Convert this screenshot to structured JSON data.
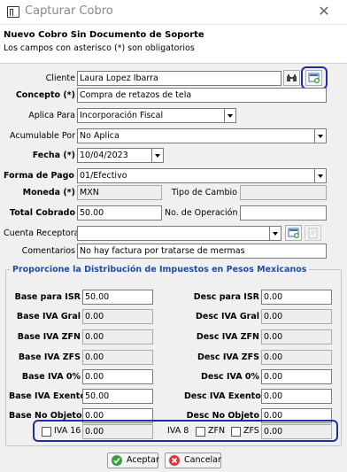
{
  "window": {
    "title": "Capturar Cobro",
    "close_glyph": "✕"
  },
  "header": {
    "title": "Nuevo Cobro Sin Documento de Soporte",
    "subtitle": "Los campos con asterisco (*) son obligatorios"
  },
  "form": {
    "cliente": {
      "label": "Cliente",
      "value": "Laura Lopez Ibarra"
    },
    "concepto": {
      "label": "Concepto (*)",
      "value": "Compra de retazos de tela"
    },
    "aplica_para": {
      "label": "Aplica Para",
      "value": "Incorporación Fiscal"
    },
    "acumulable_por": {
      "label": "Acumulable Por",
      "value": "No Aplica"
    },
    "fecha": {
      "label": "Fecha (*)",
      "value": "10/04/2023"
    },
    "forma_pago": {
      "label": "Forma de Pago (*)",
      "value": "01/Efectivo"
    },
    "moneda": {
      "label": "Moneda (*)",
      "value": "MXN"
    },
    "tipo_cambio": {
      "label": "Tipo de Cambio",
      "value": ""
    },
    "total_cobrado": {
      "label": "Total Cobrado",
      "value": "50.00"
    },
    "no_operacion": {
      "label": "No. de Operación",
      "value": ""
    },
    "cuenta_receptora": {
      "label": "Cuenta Receptora",
      "value": ""
    },
    "comentarios": {
      "label": "Comentarios",
      "value": "No hay factura por tratarse de mermas"
    }
  },
  "taxes": {
    "group_title": "Proporcione la Distribución de Impuestos en Pesos Mexicanos",
    "left": [
      {
        "label": "Base para ISR",
        "value": "50.00",
        "editable": true
      },
      {
        "label": "Base IVA Gral",
        "value": "0.00",
        "editable": false
      },
      {
        "label": "Base IVA ZFN",
        "value": "0.00",
        "editable": false
      },
      {
        "label": "Base IVA ZFS",
        "value": "0.00",
        "editable": false
      },
      {
        "label": "Base IVA 0%",
        "value": "0.00",
        "editable": true
      },
      {
        "label": "Base IVA Exento",
        "value": "50.00",
        "editable": true
      },
      {
        "label": "Base No Objeto",
        "value": "0.00",
        "editable": true
      }
    ],
    "right": [
      {
        "label": "Desc para ISR",
        "value": "0.00",
        "editable": true
      },
      {
        "label": "Desc IVA Gral",
        "value": "0.00",
        "editable": false
      },
      {
        "label": "Desc IVA ZFN",
        "value": "0.00",
        "editable": false
      },
      {
        "label": "Desc IVA ZFS",
        "value": "0.00",
        "editable": false
      },
      {
        "label": "Desc IVA 0%",
        "value": "0.00",
        "editable": true
      },
      {
        "label": "Desc IVA Exento",
        "value": "0.00",
        "editable": true
      },
      {
        "label": "Desc No Objeto",
        "value": "0.00",
        "editable": true
      }
    ],
    "iva16_label": "IVA 16",
    "iva16_value": "0.00",
    "iva8_label": "IVA 8",
    "zfn_label": "ZFN",
    "zfs_label": "ZFS",
    "iva8_value": "0.00"
  },
  "buttons": {
    "accept": "Aceptar",
    "cancel": "Cancelar"
  },
  "colors": {
    "highlight": "#1f2ea0",
    "group_title": "#1f4e9d",
    "accept_icon": "#3aa03a",
    "cancel_icon": "#d23a3a"
  }
}
